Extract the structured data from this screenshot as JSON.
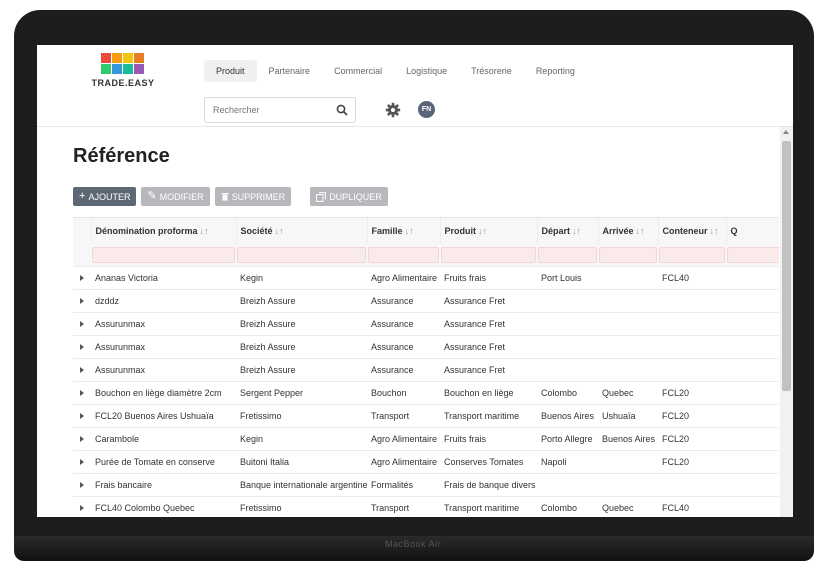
{
  "device": {
    "label": "MacBook Air"
  },
  "logo": {
    "text": "TRADE.EASY",
    "colors": [
      "#e94b3c",
      "#f39c12",
      "#f1c40f",
      "#e67e22",
      "#2ecc71",
      "#3498db",
      "#1abc9c",
      "#9b59b6"
    ]
  },
  "nav": [
    {
      "label": "Produit",
      "active": true
    },
    {
      "label": "Partenaire"
    },
    {
      "label": "Commercial"
    },
    {
      "label": "Logistique"
    },
    {
      "label": "Trésorerie"
    },
    {
      "label": "Reporting"
    }
  ],
  "search": {
    "placeholder": "Rechercher",
    "icon": "search-icon"
  },
  "user": {
    "initials": "FN"
  },
  "page": {
    "title": "Référence"
  },
  "toolbar": {
    "add_label": "AJOUTER",
    "edit_label": "MODIFIER",
    "delete_label": "SUPPRIMER",
    "duplicate_label": "DUPLIQUER"
  },
  "table": {
    "sort_glyph": "↓↑",
    "columns": [
      "Dénomination proforma",
      "Société",
      "Famille",
      "Produit",
      "Départ",
      "Arrivée",
      "Conteneur",
      "Q"
    ],
    "rows": [
      [
        "Ananas Victoria",
        "Kegin",
        "Agro Alimentaire",
        "Fruits frais",
        "Port Louis",
        "",
        "FCL40"
      ],
      [
        "dzddz",
        "Breizh Assure",
        "Assurance",
        "Assurance Fret",
        "",
        "",
        ""
      ],
      [
        "Assurunmax",
        "Breizh Assure",
        "Assurance",
        "Assurance Fret",
        "",
        "",
        ""
      ],
      [
        "Assurunmax",
        "Breizh Assure",
        "Assurance",
        "Assurance Fret",
        "",
        "",
        ""
      ],
      [
        "Assurunmax",
        "Breizh Assure",
        "Assurance",
        "Assurance Fret",
        "",
        "",
        ""
      ],
      [
        "Bouchon en liège diamètre 2cm",
        "Sergent Pepper",
        "Bouchon",
        "Bouchon en liège",
        "Colombo",
        "Quebec",
        "FCL20"
      ],
      [
        "FCL20 Buenos Aires Ushuaïa",
        "Fretissimo",
        "Transport",
        "Transport maritime",
        "Buenos Aires",
        "Ushuaïa",
        "FCL20"
      ],
      [
        "Carambole",
        "Kegin",
        "Agro Alimentaire",
        "Fruits frais",
        "Porto Allegre",
        "Buenos Aires",
        "FCL20"
      ],
      [
        "Purée de Tomate en conserve",
        "Buitoni Italia",
        "Agro Alimentaire",
        "Conserves Tomates",
        "Napoli",
        "",
        "FCL20"
      ],
      [
        "Frais bancaire",
        "Banque internationale argentine",
        "Formalités",
        "Frais de banque divers",
        "",
        "",
        ""
      ],
      [
        "FCL40 Colombo Quebec",
        "Fretissimo",
        "Transport",
        "Transport maritime",
        "Colombo",
        "Quebec",
        "FCL40"
      ]
    ]
  }
}
